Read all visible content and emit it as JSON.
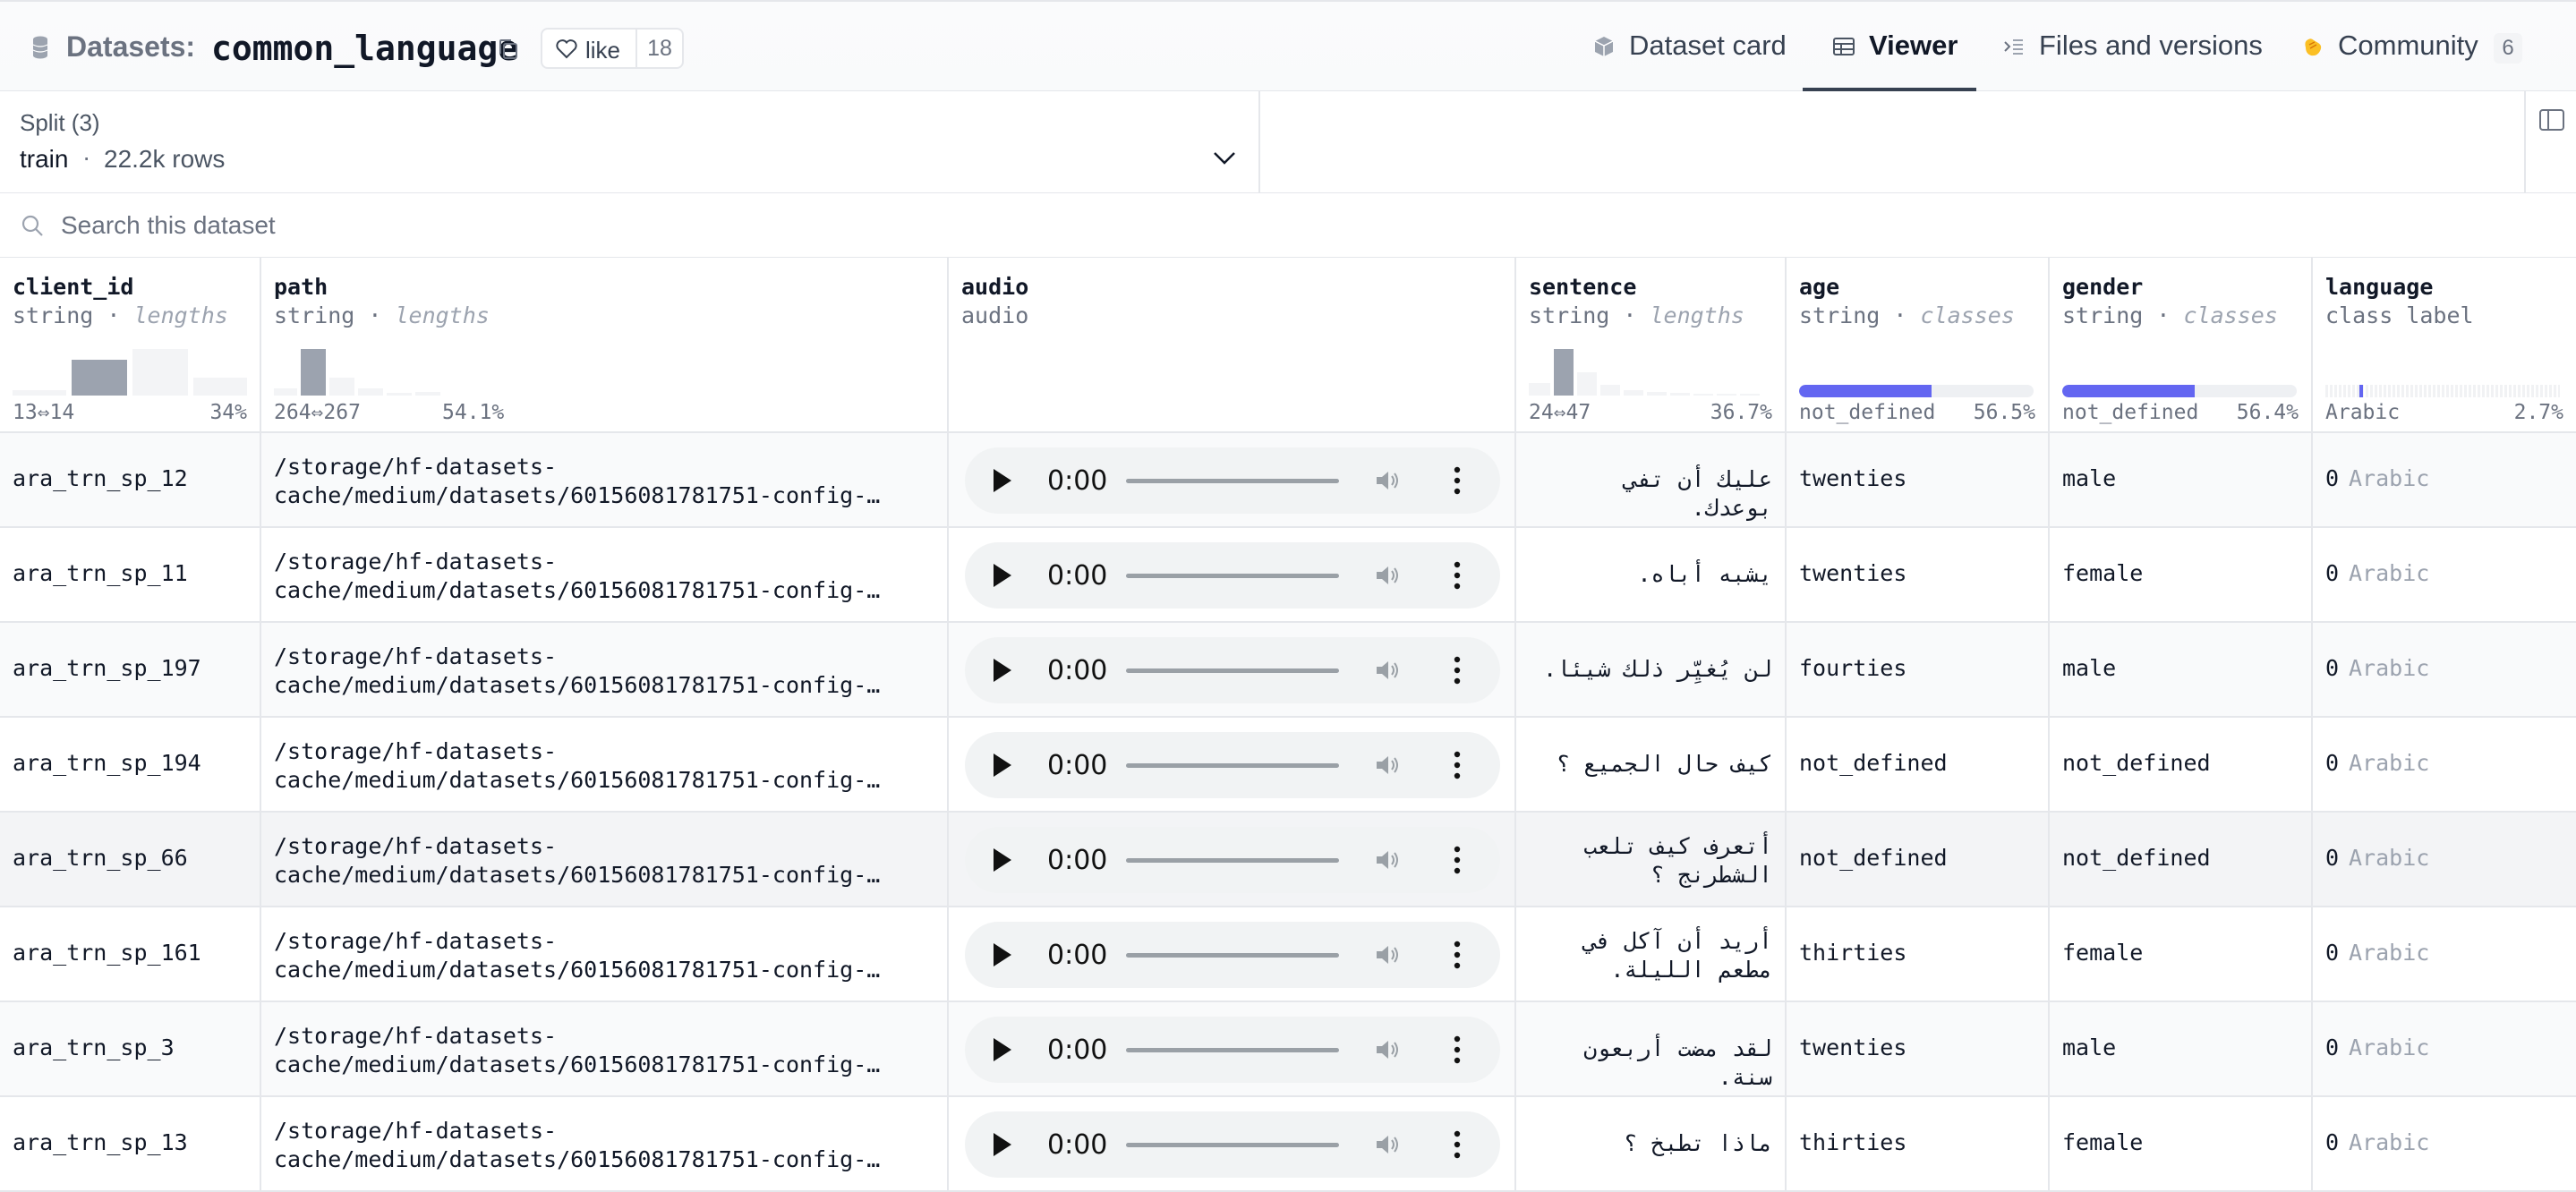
{
  "header": {
    "datasets_label": "Datasets:",
    "dataset_name": "common_language",
    "like_label": "like",
    "like_count": "18",
    "tabs": [
      {
        "label": "Dataset card",
        "icon": "dataset-card-icon"
      },
      {
        "label": "Viewer",
        "icon": "table-icon",
        "active": true
      },
      {
        "label": "Files and versions",
        "icon": "files-icon"
      },
      {
        "label": "Community",
        "icon": "community-icon",
        "badge": "6"
      }
    ]
  },
  "split": {
    "title": "Split (3)",
    "name": "train",
    "separator": "·",
    "rows": "22.2k rows"
  },
  "search": {
    "placeholder": "Search this dataset"
  },
  "columns": [
    {
      "name": "client_id",
      "type": "string",
      "stat": "lengths",
      "foot_left": "13⇔14",
      "foot_right": "34%"
    },
    {
      "name": "path",
      "type": "string",
      "stat": "lengths",
      "foot_left": "264⇔267",
      "foot_right": "54.1%"
    },
    {
      "name": "audio",
      "type": "audio"
    },
    {
      "name": "sentence",
      "type": "string",
      "stat": "lengths",
      "foot_left": "24⇔47",
      "foot_right": "36.7%"
    },
    {
      "name": "age",
      "type": "string",
      "stat": "classes",
      "foot_left": "not_defined",
      "foot_right": "56.5%",
      "fill": 0.565
    },
    {
      "name": "gender",
      "type": "string",
      "stat": "classes",
      "foot_left": "not_defined",
      "foot_right": "56.4%",
      "fill": 0.564
    },
    {
      "name": "language",
      "type": "class label",
      "foot_left": "Arabic",
      "foot_right": "2.7%"
    }
  ],
  "rows": [
    {
      "client_id": "ara_trn_sp_12",
      "path1": "/storage/hf-datasets-",
      "path2": "cache/medium/datasets/60156081781751-config-…",
      "time": "0:00",
      "sentence": "عليك أن تفي بوعدك.",
      "age": "twenties",
      "gender": "male",
      "lang_num": "0",
      "lang_name": "Arabic"
    },
    {
      "client_id": "ara_trn_sp_11",
      "path1": "/storage/hf-datasets-",
      "path2": "cache/medium/datasets/60156081781751-config-…",
      "time": "0:00",
      "sentence": "يشبه أباه.",
      "age": "twenties",
      "gender": "female",
      "lang_num": "0",
      "lang_name": "Arabic"
    },
    {
      "client_id": "ara_trn_sp_197",
      "path1": "/storage/hf-datasets-",
      "path2": "cache/medium/datasets/60156081781751-config-…",
      "time": "0:00",
      "sentence": "لن يُغيِّر ذلك شيئا.",
      "age": "fourties",
      "gender": "male",
      "lang_num": "0",
      "lang_name": "Arabic"
    },
    {
      "client_id": "ara_trn_sp_194",
      "path1": "/storage/hf-datasets-",
      "path2": "cache/medium/datasets/60156081781751-config-…",
      "time": "0:00",
      "sentence": "كيف حال الجميع ؟",
      "age": "not_defined",
      "gender": "not_defined",
      "lang_num": "0",
      "lang_name": "Arabic"
    },
    {
      "client_id": "ara_trn_sp_66",
      "path1": "/storage/hf-datasets-",
      "path2": "cache/medium/datasets/60156081781751-config-…",
      "time": "0:00",
      "sentence": "أتعرف كيف تلعب الشطرنج ؟",
      "age": "not_defined",
      "gender": "not_defined",
      "lang_num": "0",
      "lang_name": "Arabic"
    },
    {
      "client_id": "ara_trn_sp_161",
      "path1": "/storage/hf-datasets-",
      "path2": "cache/medium/datasets/60156081781751-config-…",
      "time": "0:00",
      "sentence": "أريد أن آكل في مطعم الليلة.",
      "age": "thirties",
      "gender": "female",
      "lang_num": "0",
      "lang_name": "Arabic"
    },
    {
      "client_id": "ara_trn_sp_3",
      "path1": "/storage/hf-datasets-",
      "path2": "cache/medium/datasets/60156081781751-config-…",
      "time": "0:00",
      "sentence": "لقد مضت أربعون سنة.",
      "age": "twenties",
      "gender": "male",
      "lang_num": "0",
      "lang_name": "Arabic"
    },
    {
      "client_id": "ara_trn_sp_13",
      "path1": "/storage/hf-datasets-",
      "path2": "cache/medium/datasets/60156081781751-config-…",
      "time": "0:00",
      "sentence": "ماذا تطبخ ؟",
      "age": "thirties",
      "gender": "female",
      "lang_num": "0",
      "lang_name": "Arabic"
    }
  ],
  "colors": {
    "accent": "#6366f1",
    "border": "#e5e7eb",
    "muted": "#6b7280"
  }
}
